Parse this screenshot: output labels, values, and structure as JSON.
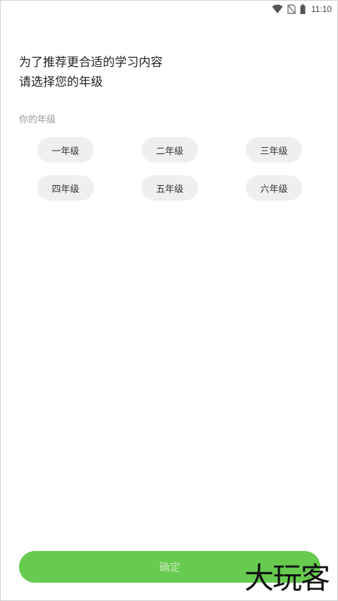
{
  "status_bar": {
    "time": "11:10",
    "icons": [
      "wifi-icon",
      "no-sim-icon",
      "battery-icon"
    ]
  },
  "headline": {
    "line1": "为了推荐更合适的学习内容",
    "line2": "请选择您的年级"
  },
  "section_label": "你的年级",
  "grades": [
    {
      "label": "一年级"
    },
    {
      "label": "二年级"
    },
    {
      "label": "三年级"
    },
    {
      "label": "四年级"
    },
    {
      "label": "五年级"
    },
    {
      "label": "六年级"
    }
  ],
  "confirm_label": "确定",
  "watermark": "大玩客",
  "colors": {
    "accent": "#67cb4f",
    "chip_bg": "#efefef"
  }
}
